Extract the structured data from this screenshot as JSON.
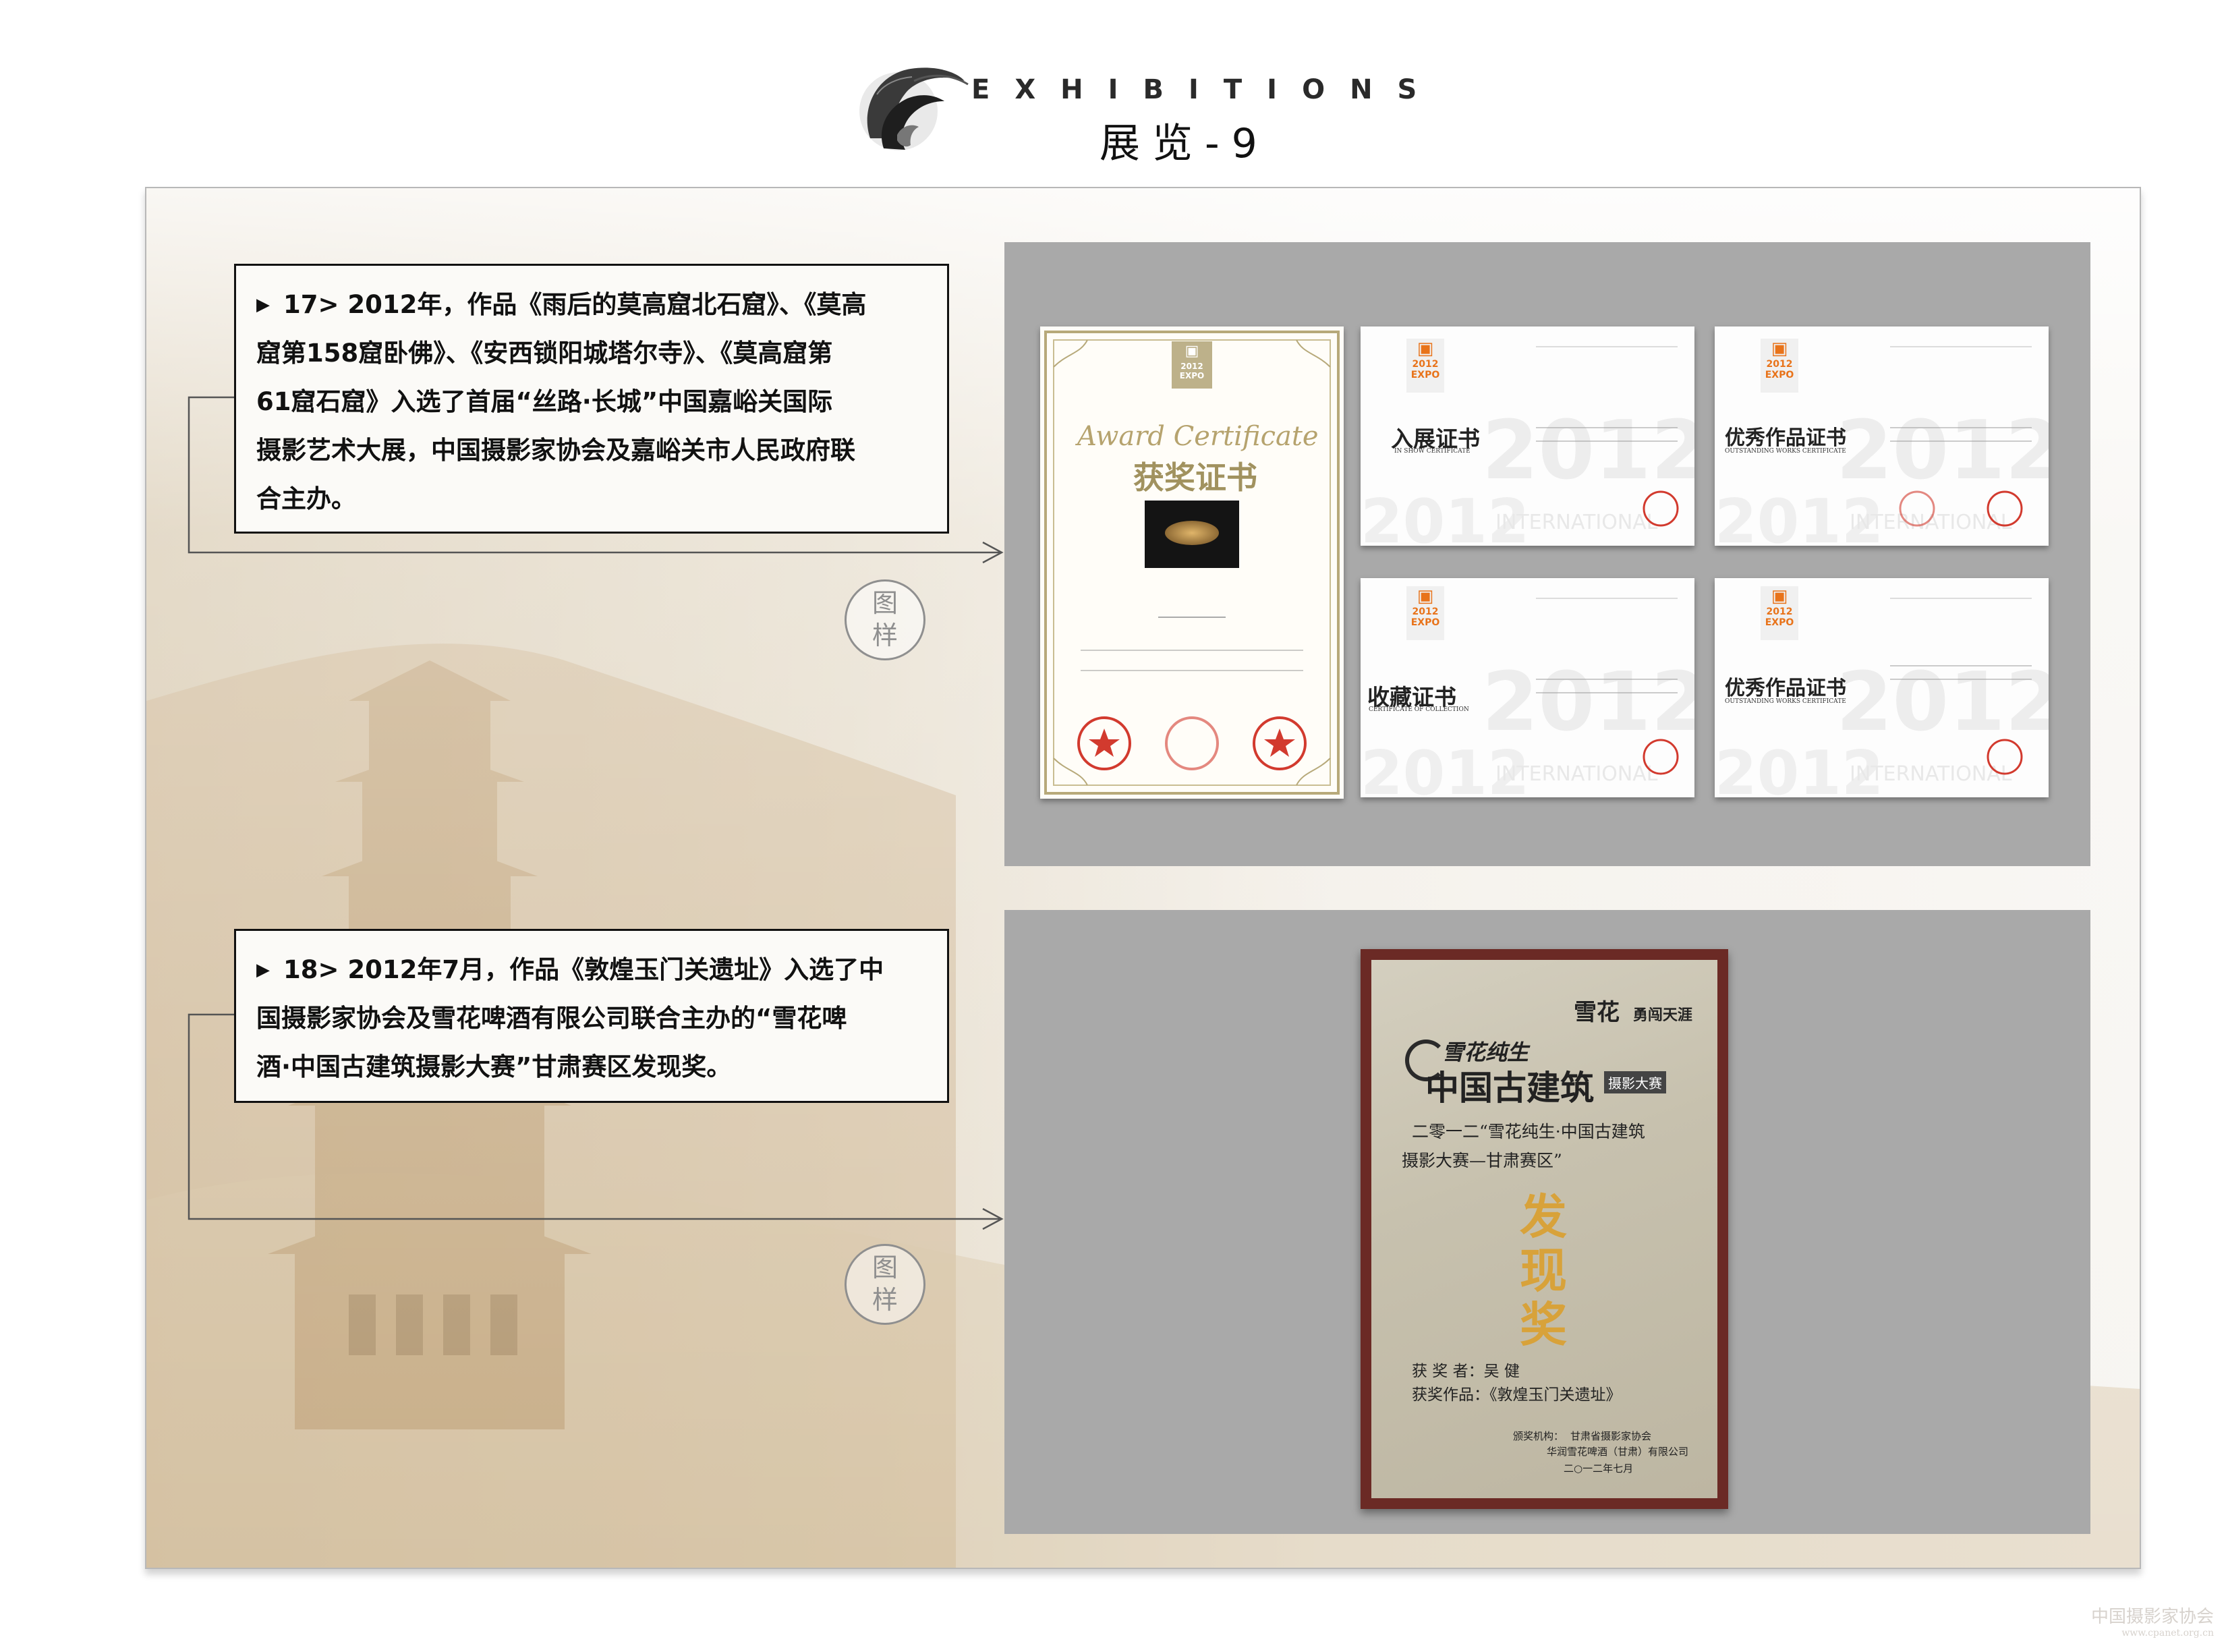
{
  "header": {
    "title_en": "EXHIBITIONS",
    "title_cn": "展览-9"
  },
  "items": [
    {
      "lines": [
        "17> 2012年，作品《雨后的莫高窟北石窟》、《莫高",
        "窟第158窟卧佛》、《安西锁阳城塔尔寺》、《莫高窟第",
        "61窟石窟》入选了首届“丝路·长城”中国嘉峪关国际",
        "摄影艺术大展，中国摄影家协会及嘉峪关市人民政府联",
        "合主办。"
      ],
      "stamp": [
        "图",
        "样"
      ]
    },
    {
      "lines": [
        "18> 2012年7月，作品《敦煌玉门关遗址》入选了中",
        "国摄影家协会及雪花啤酒有限公司联合主办的“雪花啤",
        "酒·中国古建筑摄影大赛”甘肃赛区发现奖。"
      ],
      "stamp": [
        "图",
        "样"
      ]
    }
  ],
  "certificates": {
    "award": {
      "script": "Award Certificate",
      "title": "获奖证书",
      "year": "2012",
      "logo": "EXPO"
    },
    "small": [
      {
        "title": "入展证书",
        "sub": "IN SHOW CERTIFICATE",
        "year": "2012",
        "logo": "EXPO"
      },
      {
        "title": "优秀作品证书",
        "sub": "OUTSTANDING WORKS CERTIFICATE",
        "year": "2012",
        "logo": "EXPO"
      },
      {
        "title": "收藏证书",
        "sub": "CERTIFICATE OF COLLECTION",
        "year": "2012",
        "logo": "EXPO"
      },
      {
        "title": "优秀作品证书",
        "sub": "OUTSTANDING WORKS CERTIFICATE",
        "year": "2012",
        "logo": "EXPO"
      }
    ],
    "bg_text": "2012",
    "bg_word": "INTERNATIONAL"
  },
  "plaque": {
    "brand": "雪花",
    "brand_sub": "勇闯天涯",
    "logo_cn": "雪花纯生",
    "logo_big": "中国古建筑",
    "logo_tag": "摄影大赛",
    "line1": "二零一二“雪花纯生·中国古建筑",
    "line2": "摄影大赛—甘肃赛区”",
    "award": [
      "发",
      "现",
      "奖"
    ],
    "winner": "获 奖 者：吴 健",
    "work": "获奖作品：《敦煌玉门关遗址》",
    "org_label": "颁奖机构：",
    "org1": "甘肃省摄影家协会",
    "org2": "华润雪花啤酒（甘肃）有限公司",
    "date": "二○一二年七月"
  },
  "watermark": {
    "cn": "中国摄影家协会",
    "url": "www.cpanet.org.cn"
  }
}
